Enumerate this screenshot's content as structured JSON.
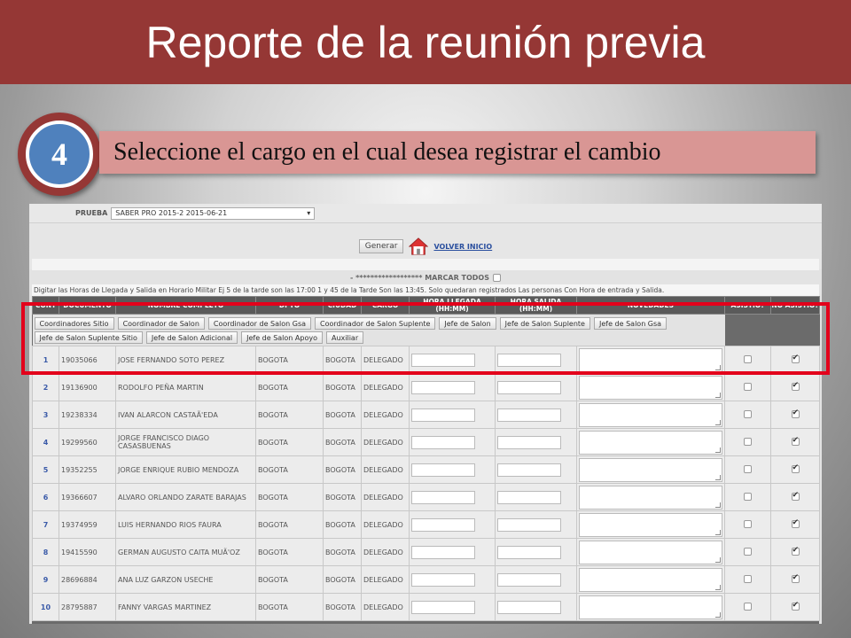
{
  "slide": {
    "title": "Reporte de la reunión previa",
    "step_number": "4",
    "step_text": "Seleccione el cargo en el cual desea registrar el cambio"
  },
  "form": {
    "prueba_label": "PRUEBA",
    "prueba_value": "SABER PRO 2015-2 2015-06-21",
    "generar_label": "Generar",
    "volver_label": "VOLVER INICIO",
    "marcar_todos": "- ****************** MARCAR TODOS",
    "info_text": "Digitar las Horas de Llegada y Salida en Horario Militar Ej 5 de la tarde son las 17:00 1 y 45 de la Tarde Son las 13:45. Solo quedaran registrados Las personas Con Hora de entrada y Salida."
  },
  "table": {
    "headers": [
      "CONT",
      "DOCUMENTO",
      "NOMBRE COMPLETO",
      "DPTO",
      "CIUDAD",
      "CARGO",
      "HORA LLEGADA (HH:MM)",
      "HORA SALIDA (HH:MM)",
      "NOVEDADES",
      "ASISTIO?",
      "NO ASISTIO?"
    ],
    "cargo_buttons": [
      "Coordinadores Sitio",
      "Coordinador de Salon",
      "Coordinador de Salon Gsa",
      "Coordinador de Salon Suplente",
      "Jefe de Salon",
      "Jefe de Salon Suplente",
      "Jefe de Salon Gsa",
      "Jefe de Salon Suplente Sitio",
      "Jefe de Salon Adicional",
      "Jefe de Salon Apoyo",
      "Auxiliar"
    ],
    "rows": [
      {
        "cont": "1",
        "documento": "19035066",
        "nombre": "JOSE FERNANDO SOTO PEREZ",
        "dpto": "BOGOTA",
        "ciudad": "BOGOTA",
        "cargo": "DELEGADO"
      },
      {
        "cont": "2",
        "documento": "19136900",
        "nombre": "RODOLFO PEÑA MARTIN",
        "dpto": "BOGOTA",
        "ciudad": "BOGOTA",
        "cargo": "DELEGADO"
      },
      {
        "cont": "3",
        "documento": "19238334",
        "nombre": "IVAN ALARCON CASTAÃ'EDA",
        "dpto": "BOGOTA",
        "ciudad": "BOGOTA",
        "cargo": "DELEGADO"
      },
      {
        "cont": "4",
        "documento": "19299560",
        "nombre": "JORGE FRANCISCO DIAGO CASASBUENAS",
        "dpto": "BOGOTA",
        "ciudad": "BOGOTA",
        "cargo": "DELEGADO"
      },
      {
        "cont": "5",
        "documento": "19352255",
        "nombre": "JORGE ENRIQUE RUBIO MENDOZA",
        "dpto": "BOGOTA",
        "ciudad": "BOGOTA",
        "cargo": "DELEGADO"
      },
      {
        "cont": "6",
        "documento": "19366607",
        "nombre": "ALVARO ORLANDO ZARATE BARAJAS",
        "dpto": "BOGOTA",
        "ciudad": "BOGOTA",
        "cargo": "DELEGADO"
      },
      {
        "cont": "7",
        "documento": "19374959",
        "nombre": "LUIS HERNANDO RIOS FAURA",
        "dpto": "BOGOTA",
        "ciudad": "BOGOTA",
        "cargo": "DELEGADO"
      },
      {
        "cont": "8",
        "documento": "19415590",
        "nombre": "GERMAN AUGUSTO CAITA MUÃ'OZ",
        "dpto": "BOGOTA",
        "ciudad": "BOGOTA",
        "cargo": "DELEGADO"
      },
      {
        "cont": "9",
        "documento": "28696884",
        "nombre": "ANA LUZ GARZON USECHE",
        "dpto": "BOGOTA",
        "ciudad": "BOGOTA",
        "cargo": "DELEGADO"
      },
      {
        "cont": "10",
        "documento": "28795887",
        "nombre": "FANNY VARGAS MARTINEZ",
        "dpto": "BOGOTA",
        "ciudad": "BOGOTA",
        "cargo": "DELEGADO"
      }
    ]
  },
  "colors": {
    "title_bar": "#953735",
    "banner": "#d99694",
    "step_circle": "#4f81bd",
    "highlight": "#e3001b"
  }
}
